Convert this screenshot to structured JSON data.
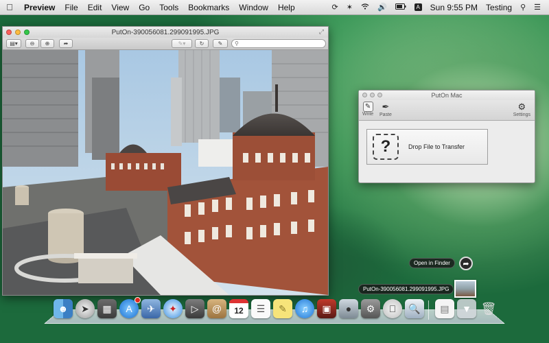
{
  "menubar": {
    "app_name": "Preview",
    "menus": [
      "File",
      "Edit",
      "View",
      "Go",
      "Tools",
      "Bookmarks",
      "Window",
      "Help"
    ],
    "clock": "Sun 9:55 PM",
    "user": "Testing",
    "input_badge": "A"
  },
  "preview": {
    "window_title": "PutOn-390056081.299091995.JPG"
  },
  "puton": {
    "window_title": "PutOn Mac",
    "write_label": "Write",
    "paste_label": "Paste",
    "settings_label": "Settings",
    "drop_icon": "?",
    "drop_label": "Drop File to Transfer"
  },
  "floating": {
    "open_in_finder": "Open in Finder",
    "file_name": "PutOn-390056081.299091995.JPG"
  },
  "dock": {
    "calendar_day": "12"
  }
}
